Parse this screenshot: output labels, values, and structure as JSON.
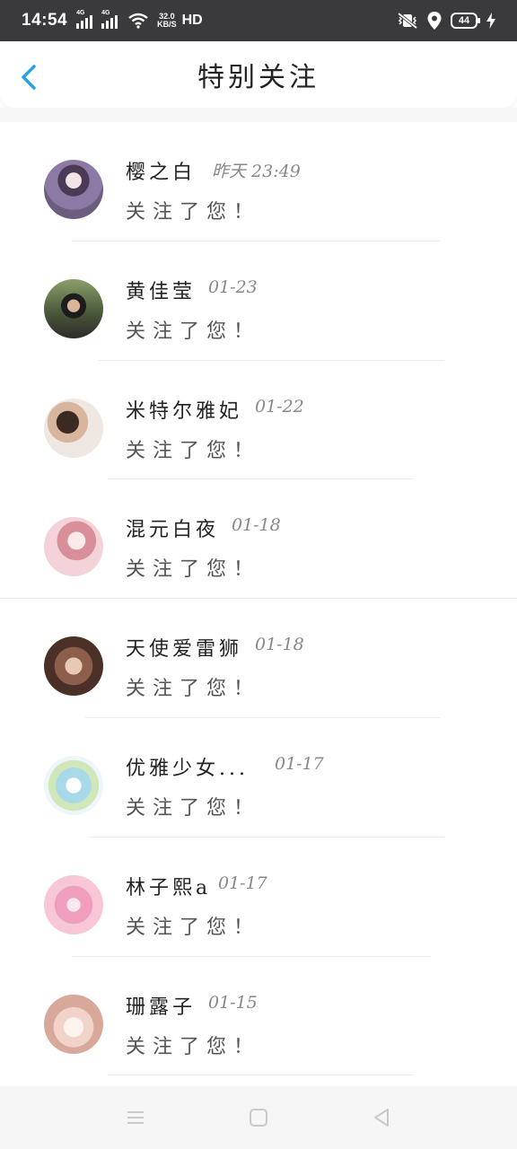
{
  "status_bar": {
    "time": "14:54",
    "sim1_tag": "4G",
    "sim2_tag": "4G",
    "speed_value": "32.0",
    "speed_unit": "KB/S",
    "hd": "HD",
    "battery": "44",
    "icons": [
      "signal-icon",
      "wifi-icon",
      "mute-vibrate-icon",
      "location-icon",
      "battery-icon",
      "charging-icon"
    ]
  },
  "header": {
    "title": "特别关注",
    "back_icon": "chevron-left-icon",
    "accent": "#2aa3e6"
  },
  "notifications": [
    {
      "name": "樱之白",
      "time": "昨天 23:49",
      "message": "关注了您！",
      "avatar_color": "#6a5d7d"
    },
    {
      "name": "黄佳莹",
      "time": "01-23",
      "message": "关注了您！",
      "avatar_color": "#4c5a3c"
    },
    {
      "name": "米特尔雅妃",
      "time": "01-22",
      "message": "关注了您！",
      "avatar_color": "#7a5544"
    },
    {
      "name": "混元白夜",
      "time": "01-18",
      "message": "关注了您！",
      "avatar_color": "#e9b7bf"
    },
    {
      "name": "天使爱雷狮",
      "time": "01-18",
      "message": "关注了您！",
      "avatar_color": "#8c5e4b"
    },
    {
      "name": "优雅少女...",
      "time": "01-17",
      "message": "关注了您！",
      "avatar_color": "#a7d9e8"
    },
    {
      "name": "林子熙a",
      "time": "01-17",
      "message": "关注了您！",
      "avatar_color": "#ef9fbd"
    },
    {
      "name": "珊露子",
      "time": "01-15",
      "message": "关注了您！",
      "avatar_color": "#f1d3c9"
    }
  ],
  "nav_bar": {
    "icons": [
      "menu-icon",
      "home-icon",
      "back-triangle-icon"
    ]
  }
}
